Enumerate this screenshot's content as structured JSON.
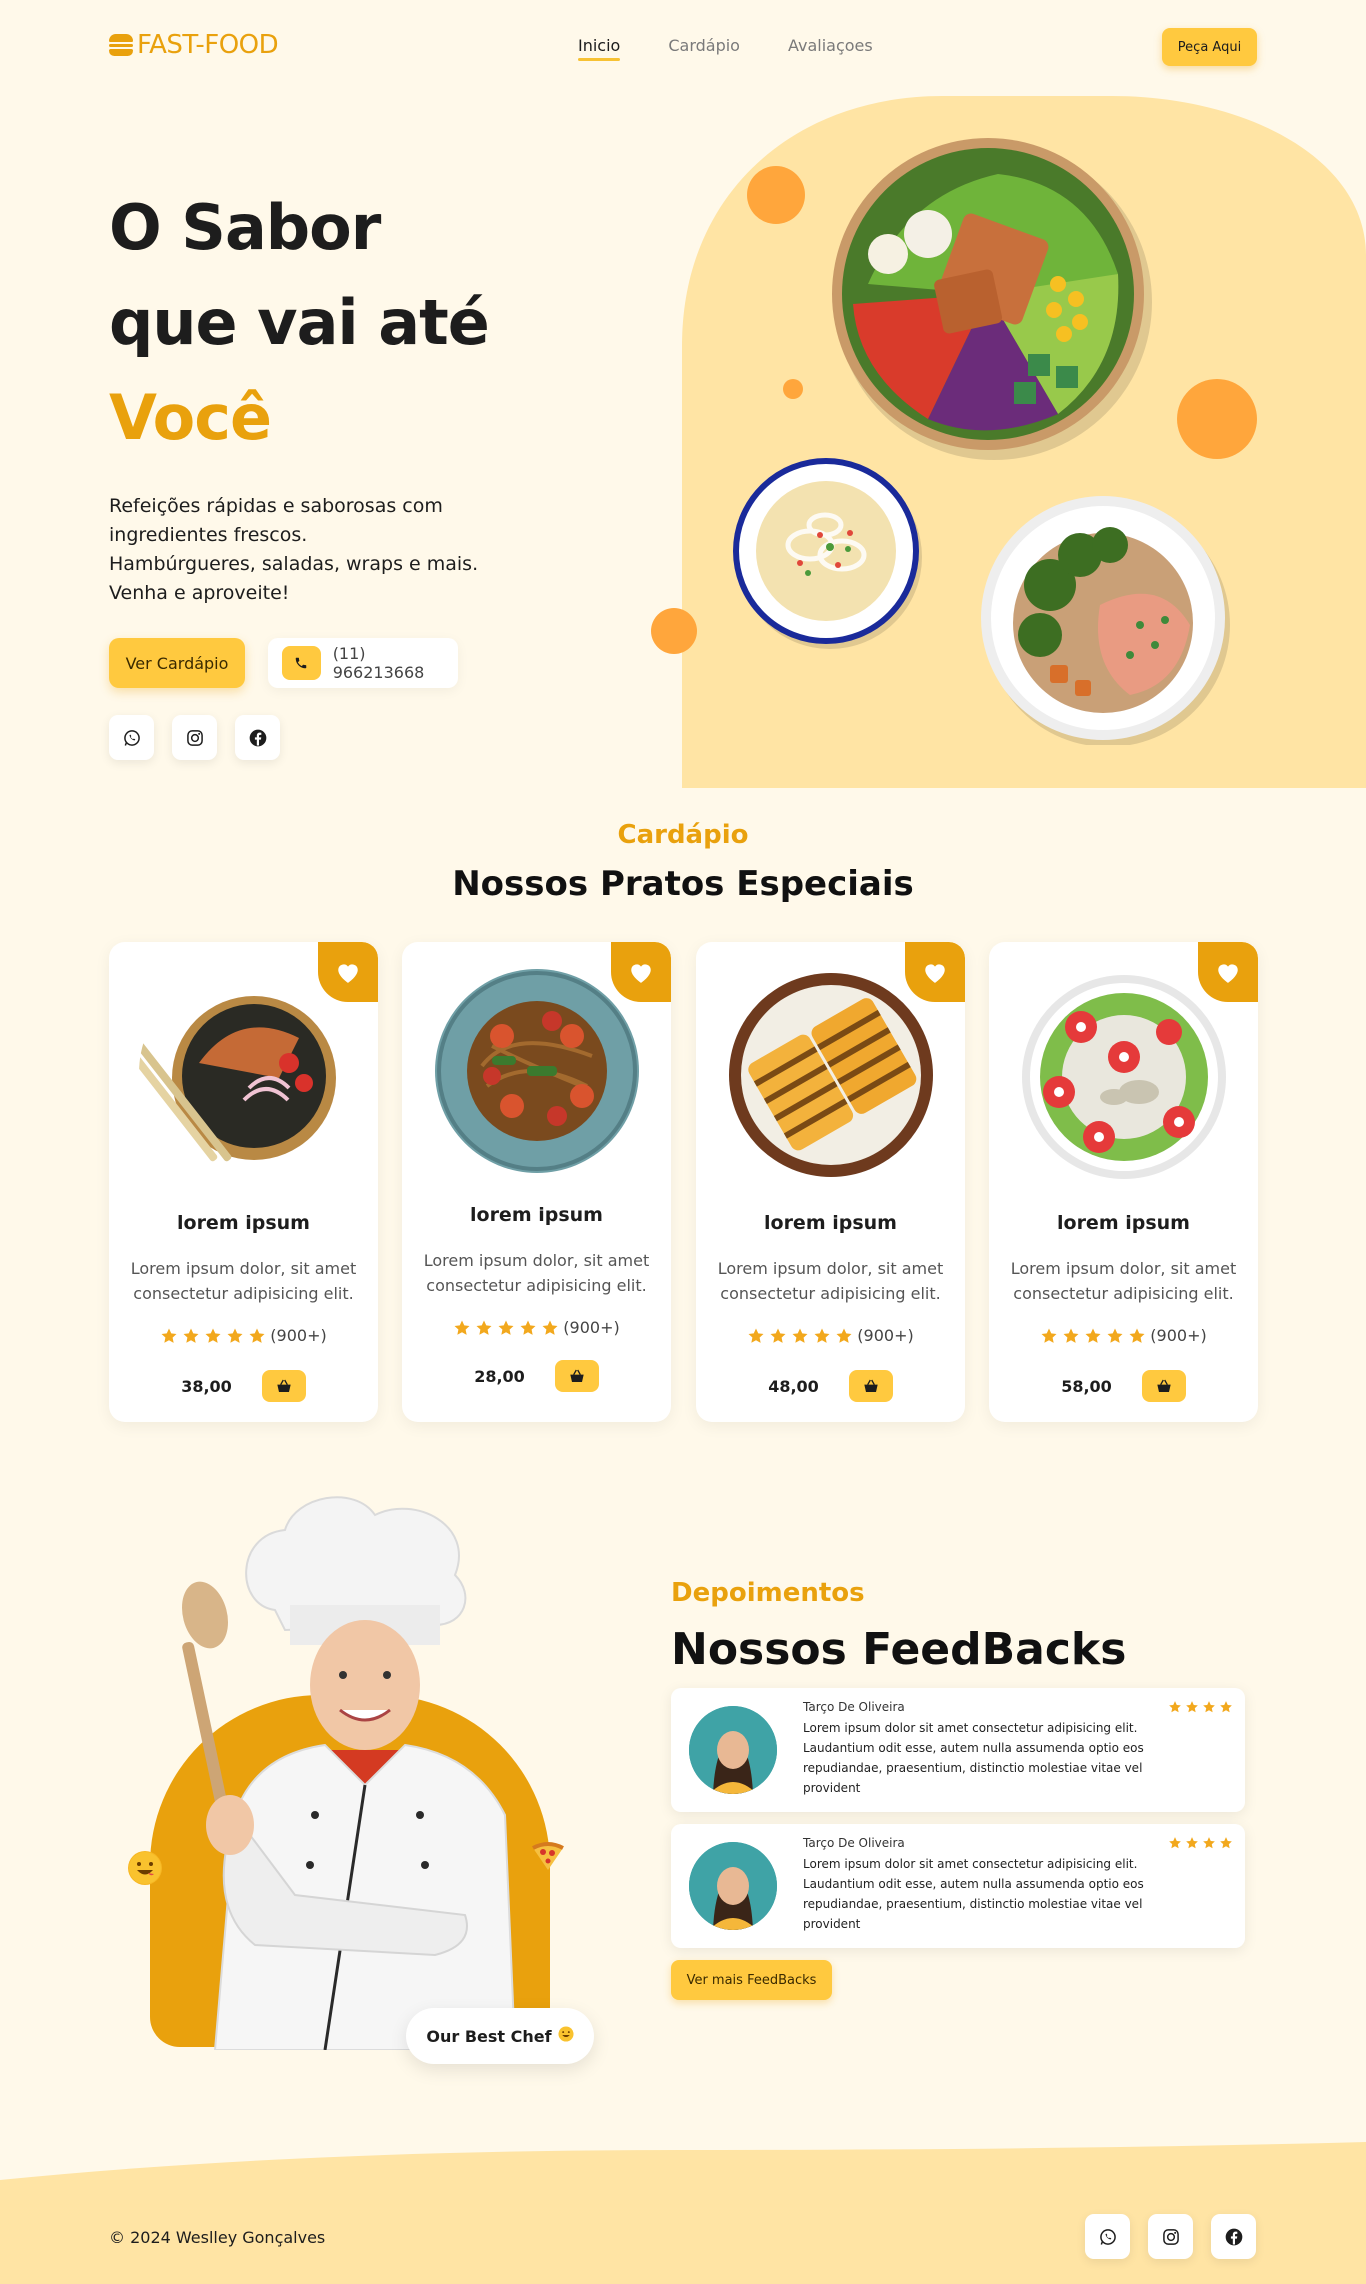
{
  "brand": {
    "logo_text": "FAST-FOOD",
    "accent": "#e9a10d",
    "yellow": "#ffc93f",
    "bg": "#fff9ea"
  },
  "nav": {
    "items": [
      "Inicio",
      "Cardápio",
      "Avaliaçoes"
    ],
    "active": "Inicio"
  },
  "header": {
    "order_button": "Peça Aqui"
  },
  "hero": {
    "title_line1": "O Sabor",
    "title_line2": "que vai até",
    "title_accent": "Você",
    "desc_line1": "Refeições rápidas e saborosas com",
    "desc_line2": "ingredientes frescos.",
    "desc_line3": "Hambúrgueres, saladas, wraps e mais.",
    "desc_line4": "Venha e aproveite!",
    "menu_button": "Ver Cardápio",
    "phone": "(11) 966213668",
    "socials": [
      "whatsapp-icon",
      "instagram-icon",
      "facebook-icon"
    ]
  },
  "menu": {
    "subtitle": "Cardápio",
    "title": "Nossos Pratos Especiais",
    "cards": [
      {
        "name": "lorem ipsum",
        "desc1": "Lorem ipsum dolor, sit amet",
        "desc2": "consectetur adipisicing elit.",
        "reviews": "(900+)",
        "rating": 5,
        "price": "38,00"
      },
      {
        "name": "lorem ipsum",
        "desc1": "Lorem ipsum dolor, sit amet",
        "desc2": "consectetur adipisicing elit.",
        "reviews": "(900+)",
        "rating": 5,
        "price": "28,00"
      },
      {
        "name": "lorem ipsum",
        "desc1": "Lorem ipsum dolor, sit amet",
        "desc2": "consectetur adipisicing elit.",
        "reviews": "(900+)",
        "rating": 5,
        "price": "48,00"
      },
      {
        "name": "lorem ipsum",
        "desc1": "Lorem ipsum dolor, sit amet",
        "desc2": "consectetur adipisicing elit.",
        "reviews": "(900+)",
        "rating": 5,
        "price": "58,00"
      }
    ]
  },
  "testimonials": {
    "subtitle": "Depoimentos",
    "title": "Nossos FeedBacks",
    "chef_tag": "Our Best Chef",
    "items": [
      {
        "name": "Tarço De Oliveira",
        "rating": 4,
        "text": "Lorem ipsum dolor sit amet consectetur adipisicing elit. Laudantium odit esse, autem nulla assumenda optio eos repudiandae, praesentium, distinctio molestiae vitae vel provident"
      },
      {
        "name": "Tarço De Oliveira",
        "rating": 4,
        "text": "Lorem ipsum dolor sit amet consectetur adipisicing elit. Laudantium odit esse, autem nulla assumenda optio eos repudiandae, praesentium, distinctio molestiae vitae vel provident"
      }
    ],
    "more_button": "Ver mais FeedBacks"
  },
  "footer": {
    "copyright": "© 2024 Weslley Gonçalves"
  }
}
